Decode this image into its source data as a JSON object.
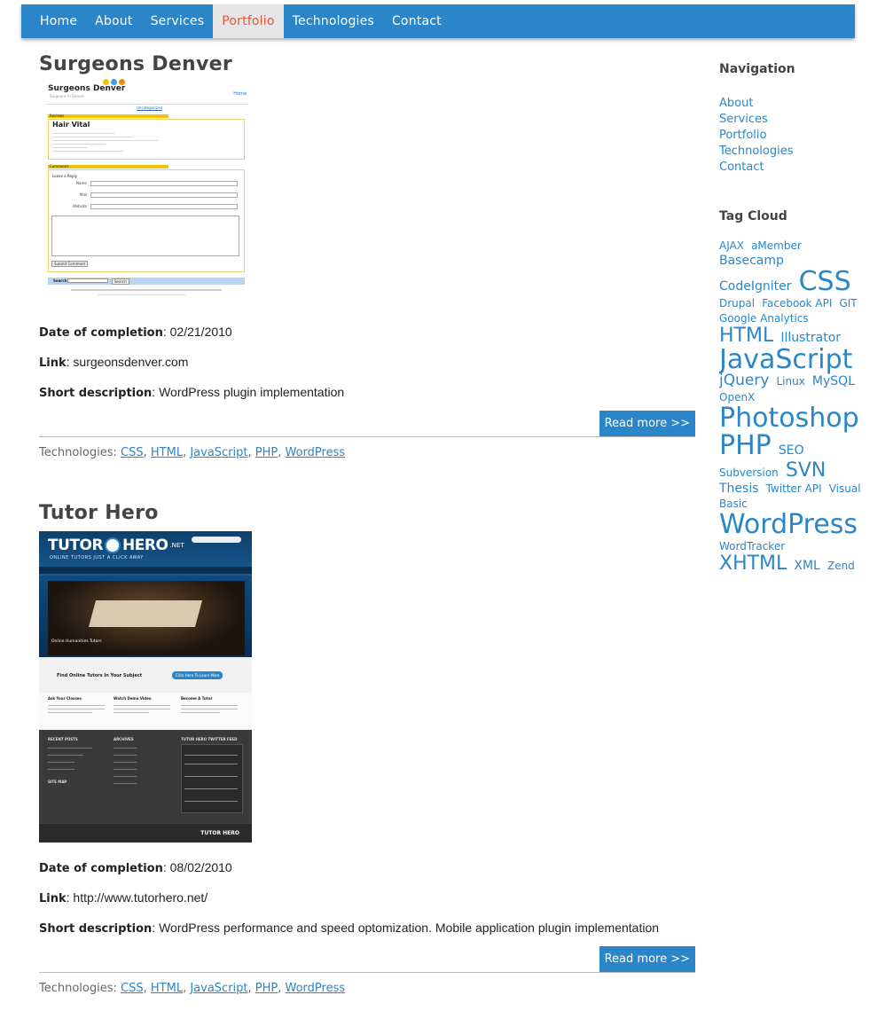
{
  "nav": {
    "items": [
      {
        "label": "Home"
      },
      {
        "label": "About"
      },
      {
        "label": "Services"
      },
      {
        "label": "Portfolio",
        "active": true
      },
      {
        "label": "Technologies"
      },
      {
        "label": "Contact"
      }
    ]
  },
  "posts": [
    {
      "title": "Surgeons Denver",
      "thumb": {
        "site_title": "Surgeons Denver",
        "site_sub": "Surgeons in Denver",
        "home_link": "Home",
        "uncat": "Uncategorized",
        "entry_title": "Hair Vital",
        "reviews": "Reviews",
        "comments": "Comments",
        "leave_reply": "Leave a Reply",
        "name_label": "Name",
        "mail_label": "Mail",
        "website_label": "Website",
        "submit": "Submit Comment",
        "search_label": "Search",
        "search_btn": "Search"
      },
      "date_label": "Date of completion",
      "date": "02/21/2010",
      "link_label": "Link",
      "link": "surgeonsdenver.com",
      "desc_label": "Short description",
      "desc": "WordPress plugin implementation",
      "read_more": "Read more >>",
      "tech_label": "Technologies:",
      "techs": [
        "CSS",
        "HTML",
        "JavaScript",
        "PHP",
        "WordPress"
      ]
    },
    {
      "title": "Tutor Hero",
      "thumb": {
        "logo_left": "TUTOR",
        "logo_right": "HERO",
        "logo_net": ".NET",
        "tagline": "ONLINE TUTORS JUST A CLICK AWAY",
        "banner_caption": "Online Humanities Tutors",
        "find": "Find Online Tutors In Your Subject",
        "cta": "Click Here To Learn More",
        "col1": "Ask Your Classes",
        "col2": "Watch Demo Video",
        "col3": "Become A Tutor",
        "footer1": "RECENT POSTS",
        "footer2": "ARCHIVES",
        "footer3": "TUTOR HERO TWITTER FEED",
        "sitemap": "SITE MAP",
        "footer_logo": "TUTOR HERO"
      },
      "date_label": "Date of completion",
      "date": "08/02/2010",
      "link_label": "Link",
      "link": "http://www.tutorhero.net/",
      "desc_label": "Short description",
      "desc": "WordPress performance and speed optomization. Mobile application plugin implementation",
      "read_more": "Read more >>",
      "tech_label": "Technologies:",
      "techs": [
        "CSS",
        "HTML",
        "JavaScript",
        "PHP",
        "WordPress"
      ]
    }
  ],
  "sidebar": {
    "nav_heading": "Navigation",
    "nav_items": [
      "About",
      "Services",
      "Portfolio",
      "Technologies",
      "Contact"
    ],
    "tag_heading": "Tag Cloud",
    "tags": [
      {
        "label": "AJAX",
        "size": "sm"
      },
      {
        "label": "aMember",
        "size": "sm"
      },
      {
        "label": "Basecamp",
        "size": "md"
      },
      {
        "label": "CodeIgniter",
        "size": "md"
      },
      {
        "label": "CSS",
        "size": "xxl"
      },
      {
        "label": "Drupal",
        "size": "sm"
      },
      {
        "label": "Facebook API",
        "size": "sm"
      },
      {
        "label": "GIT",
        "size": "sm"
      },
      {
        "label": "Google Analytics",
        "size": "sm"
      },
      {
        "label": "HTML",
        "size": "xl"
      },
      {
        "label": "Illustrator",
        "size": "md"
      },
      {
        "label": "JavaScript",
        "size": "xxl"
      },
      {
        "label": "jQuery",
        "size": "lg"
      },
      {
        "label": "Linux",
        "size": "sm"
      },
      {
        "label": "MySQL",
        "size": "md"
      },
      {
        "label": "OpenX",
        "size": "sm"
      },
      {
        "label": "Photoshop",
        "size": "xxl"
      },
      {
        "label": "PHP",
        "size": "xxl"
      },
      {
        "label": "SEO",
        "size": "md"
      },
      {
        "label": "Subversion",
        "size": "sm"
      },
      {
        "label": "SVN",
        "size": "xl"
      },
      {
        "label": "Thesis",
        "size": "md"
      },
      {
        "label": "Twitter API",
        "size": "sm"
      },
      {
        "label": "Visual Basic",
        "size": "sm"
      },
      {
        "label": "WordPress",
        "size": "xxl"
      },
      {
        "label": "WordTracker",
        "size": "sm"
      },
      {
        "label": "XHTML",
        "size": "xl"
      },
      {
        "label": "XML",
        "size": "md"
      },
      {
        "label": "Zend",
        "size": "sm"
      }
    ]
  },
  "colors": {
    "accent": "#2a86c9",
    "active_nav_text": "#e05a3a"
  }
}
